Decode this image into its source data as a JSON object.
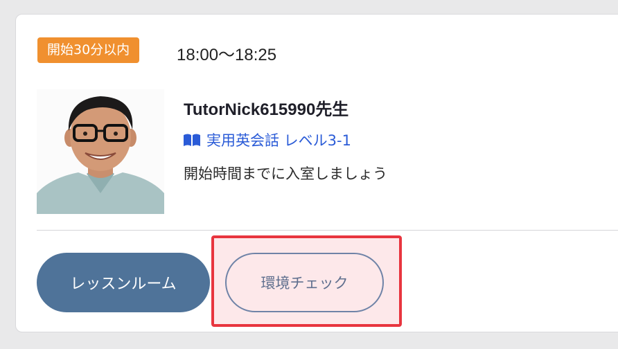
{
  "lesson": {
    "badge": "開始30分以内",
    "time_range": "18:00〜18:25",
    "tutor_name": "TutorNick615990先生",
    "course": "実用英会話 レベル3-1",
    "message": "開始時間までに入室しましょう"
  },
  "actions": {
    "lesson_room_label": "レッスンルーム",
    "env_check_label": "環境チェック"
  },
  "icons": {
    "course": "book-icon"
  },
  "colors": {
    "badge_bg": "#f0902f",
    "link": "#2a5bd7",
    "primary_button": "#4f7399",
    "outline_button": "#6f83a7",
    "highlight": "#e8353f"
  }
}
